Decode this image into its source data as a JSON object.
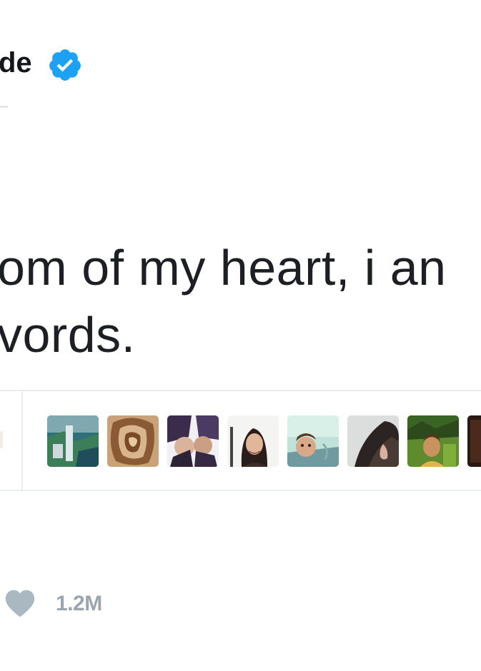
{
  "header": {
    "account_name_fragment": "de",
    "verified_icon": "verified-badge-icon",
    "colors": {
      "verified": "#1da1f2"
    }
  },
  "tweet": {
    "text_lines": [
      "om of my heart, i an",
      "vords."
    ]
  },
  "stats": {
    "likers": [
      {
        "icon": "liker-avatar-waterfall"
      },
      {
        "icon": "liker-avatar-sketch"
      },
      {
        "icon": "liker-avatar-duo"
      },
      {
        "icon": "liker-avatar-portrait"
      },
      {
        "icon": "liker-avatar-selfie"
      },
      {
        "icon": "liker-avatar-hair"
      },
      {
        "icon": "liker-avatar-outdoor"
      },
      {
        "icon": "liker-avatar-partial"
      }
    ]
  },
  "actions": {
    "like_icon": "heart-icon",
    "like_count": "1.2M",
    "colors": {
      "muted": "#aab8c2"
    }
  }
}
